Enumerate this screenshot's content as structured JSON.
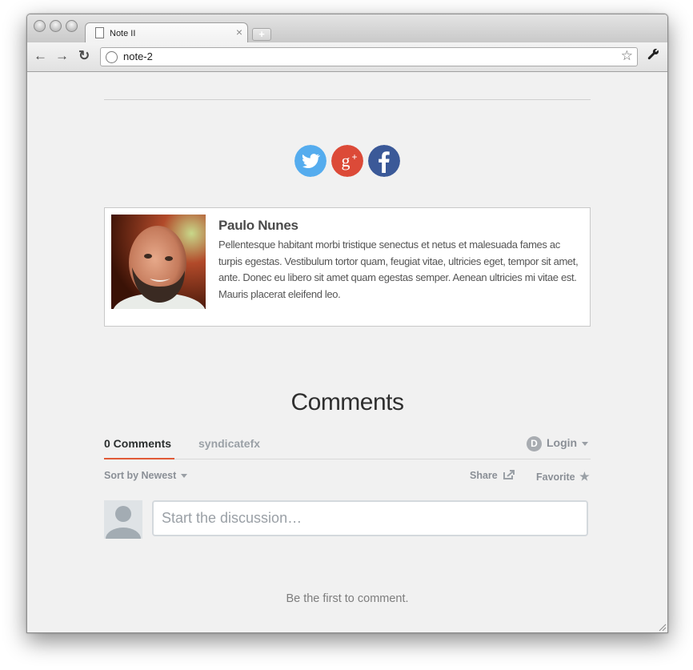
{
  "browser": {
    "tab_title": "Note II",
    "url": "note-2"
  },
  "social": {
    "icons": [
      "twitter-icon",
      "google-plus-icon",
      "facebook-icon"
    ],
    "colors": {
      "twitter": "#55acee",
      "google_plus": "#dc4a38",
      "facebook": "#3b5998"
    }
  },
  "author": {
    "name": "Paulo Nunes",
    "bio": "Pellentesque habitant morbi tristique senectus et netus et malesuada fames ac turpis egestas. Vestibulum tortor quam, feugiat vitae, ultricies eget, tempor sit amet, ante. Donec eu libero sit amet quam egestas semper. Aenean ultricies mi vitae est. Mauris placerat eleifend leo."
  },
  "comments": {
    "title": "Comments",
    "tab_active": "0 Comments",
    "tab_site": "syndicatefx",
    "login_label": "Login",
    "sort_label": "Sort by Newest",
    "share_label": "Share",
    "favorite_label": "Favorite",
    "input_placeholder": "Start the discussion…",
    "empty_message": "Be the first to comment.",
    "accent_color": "#e05a37"
  }
}
